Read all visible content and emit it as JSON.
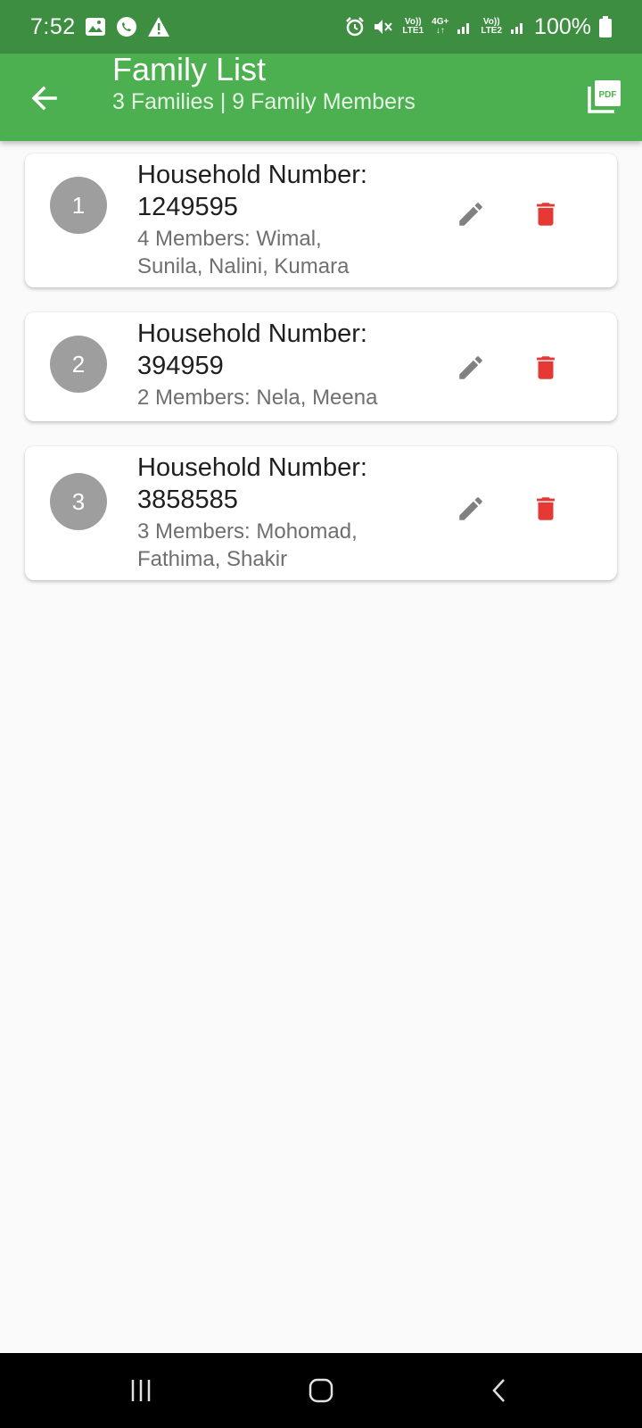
{
  "status_bar": {
    "time": "7:52",
    "sim1_label_top": "Vo))",
    "sim1_label_bottom": "LTE1",
    "network_label_top": "4G+",
    "network_label_bottom": "↓↑",
    "sim2_label_top": "Vo))",
    "sim2_label_bottom": "LTE2",
    "battery_percent": "100%"
  },
  "app_bar": {
    "title": "Family List",
    "subtitle": "3 Families | 9 Family Members",
    "back_icon": "arrow-back-icon",
    "pdf_icon": "pdf-export-icon"
  },
  "families": [
    {
      "index": "1",
      "household_label": "Household Number:",
      "household_number": "1249595",
      "members_line1": "4 Members: Wimal,",
      "members_line2": "Sunila, Nalini, Kumara"
    },
    {
      "index": "2",
      "household_label": "Household Number:",
      "household_number": "394959",
      "members_line1": "2 Members: Nela, Meena",
      "members_line2": ""
    },
    {
      "index": "3",
      "household_label": "Household Number:",
      "household_number": "3858585",
      "members_line1": "3 Members: Mohomad,",
      "members_line2": "Fathima, Shakir"
    }
  ],
  "colors": {
    "status_bar": "#3e8e41",
    "app_bar": "#4caf50",
    "avatar": "#9e9e9e",
    "edit_icon": "#808080",
    "delete_icon": "#e53935",
    "background": "#fafafa"
  }
}
